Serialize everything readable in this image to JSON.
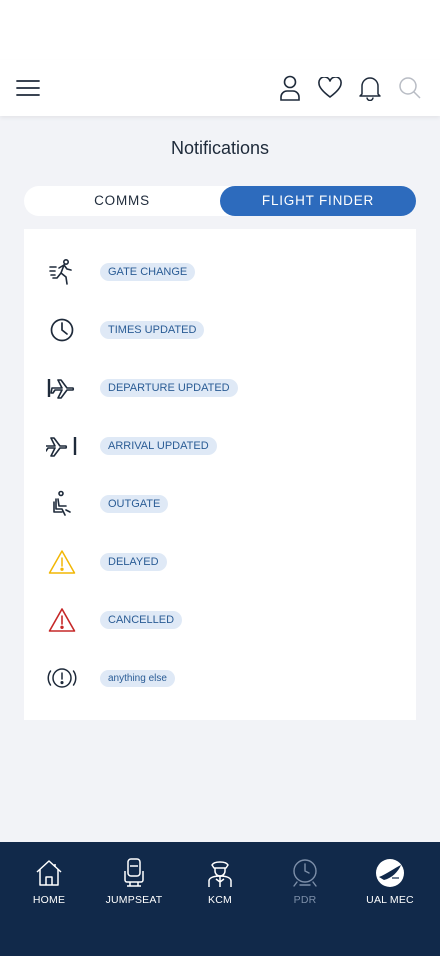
{
  "header": {
    "menu_icon": "hamburger-icon",
    "icons": [
      "user-icon",
      "heart-icon",
      "bell-icon",
      "search-icon"
    ]
  },
  "page": {
    "title": "Notifications"
  },
  "tabs": [
    {
      "label": "COMMS",
      "active": false
    },
    {
      "label": "FLIGHT FINDER",
      "active": true
    }
  ],
  "legend": [
    {
      "icon": "running-person-icon",
      "label": "GATE CHANGE"
    },
    {
      "icon": "clock-icon",
      "label": "TIMES UPDATED"
    },
    {
      "icon": "plane-departure-icon",
      "label": "DEPARTURE UPDATED"
    },
    {
      "icon": "plane-arrival-icon",
      "label": "ARRIVAL UPDATED"
    },
    {
      "icon": "seated-person-icon",
      "label": "OUTGATE"
    },
    {
      "icon": "warning-yellow-icon",
      "label": "DELAYED"
    },
    {
      "icon": "warning-red-icon",
      "label": "CANCELLED"
    },
    {
      "icon": "alert-circle-icon",
      "label": "anything else"
    }
  ],
  "bottom_nav": [
    {
      "icon": "home-icon",
      "label": "HOME",
      "enabled": true
    },
    {
      "icon": "jumpseat-icon",
      "label": "JUMPSEAT",
      "enabled": true
    },
    {
      "icon": "pilot-icon",
      "label": "KCM",
      "enabled": true
    },
    {
      "icon": "pdr-clock-icon",
      "label": "PDR",
      "enabled": false
    },
    {
      "icon": "ual-mec-logo-icon",
      "label": "UAL MEC",
      "enabled": true
    }
  ],
  "colors": {
    "accent": "#2d6bbd",
    "nav_bg": "#11294a",
    "badge_bg": "#dfe9f6",
    "badge_text": "#2a5c95",
    "warning_yellow": "#f2b705",
    "warning_red": "#c62828"
  }
}
